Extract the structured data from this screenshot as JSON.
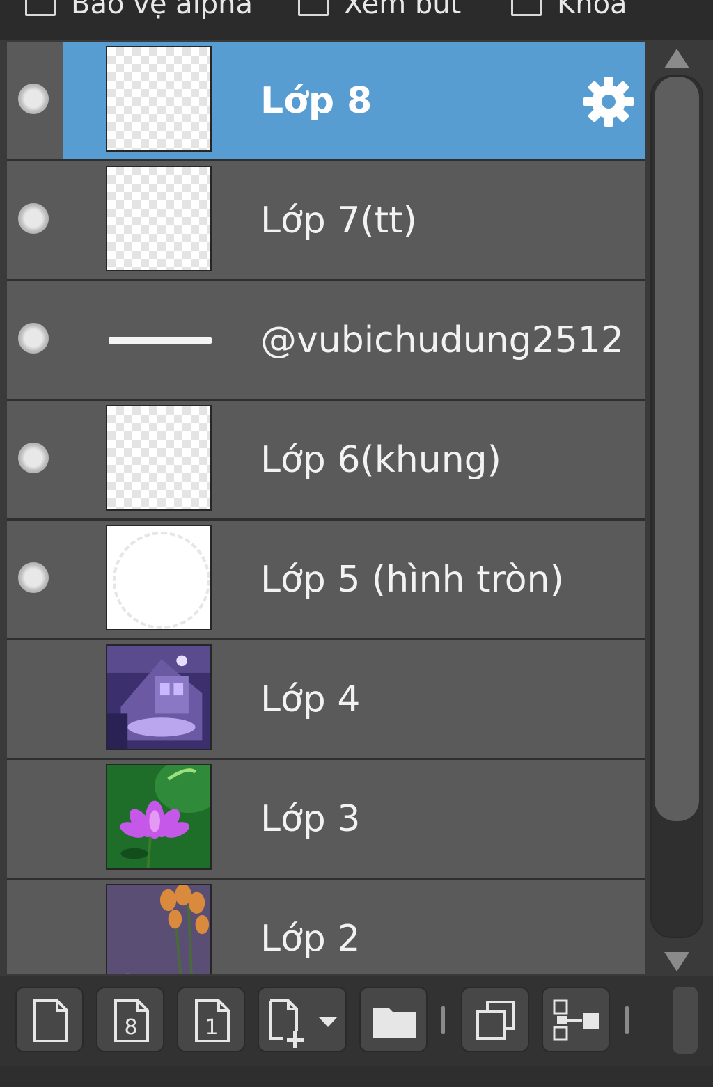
{
  "options": [
    {
      "label": "Bảo vệ alpha",
      "checked": false
    },
    {
      "label": "Xem bút",
      "checked": false
    },
    {
      "label": "Khóa",
      "checked": false
    }
  ],
  "layers": [
    {
      "name": "Lớp 8",
      "selected": true,
      "visible": true,
      "thumb": "transparent"
    },
    {
      "name": "Lớp 7(tt)",
      "selected": false,
      "visible": true,
      "thumb": "transparent"
    },
    {
      "name": "@vubichudung2512",
      "selected": false,
      "visible": true,
      "thumb": "line"
    },
    {
      "name": "Lớp 6(khung)",
      "selected": false,
      "visible": true,
      "thumb": "transparent"
    },
    {
      "name": "Lớp 5 (hình tròn)",
      "selected": false,
      "visible": true,
      "thumb": "circle"
    },
    {
      "name": "Lớp 4",
      "selected": false,
      "visible": false,
      "thumb": "purple-room-image"
    },
    {
      "name": "Lớp 3",
      "selected": false,
      "visible": false,
      "thumb": "lotus-image"
    },
    {
      "name": "Lớp 2",
      "selected": false,
      "visible": false,
      "thumb": "orange-flowers-image"
    }
  ],
  "toolbar": {
    "buttons": [
      {
        "icon": "new-layer-icon"
      },
      {
        "icon": "new-8bit-layer-icon",
        "glyph": "8"
      },
      {
        "icon": "new-1bit-layer-icon",
        "glyph": "1"
      },
      {
        "icon": "add-layer-dropdown-icon"
      },
      {
        "icon": "folder-icon"
      },
      {
        "icon": "duplicate-layer-icon"
      },
      {
        "icon": "merge-layer-icon"
      }
    ]
  },
  "colors": {
    "selected": "#579dd2",
    "row": "#5a5a5a",
    "panel": "#3a3a3a"
  }
}
